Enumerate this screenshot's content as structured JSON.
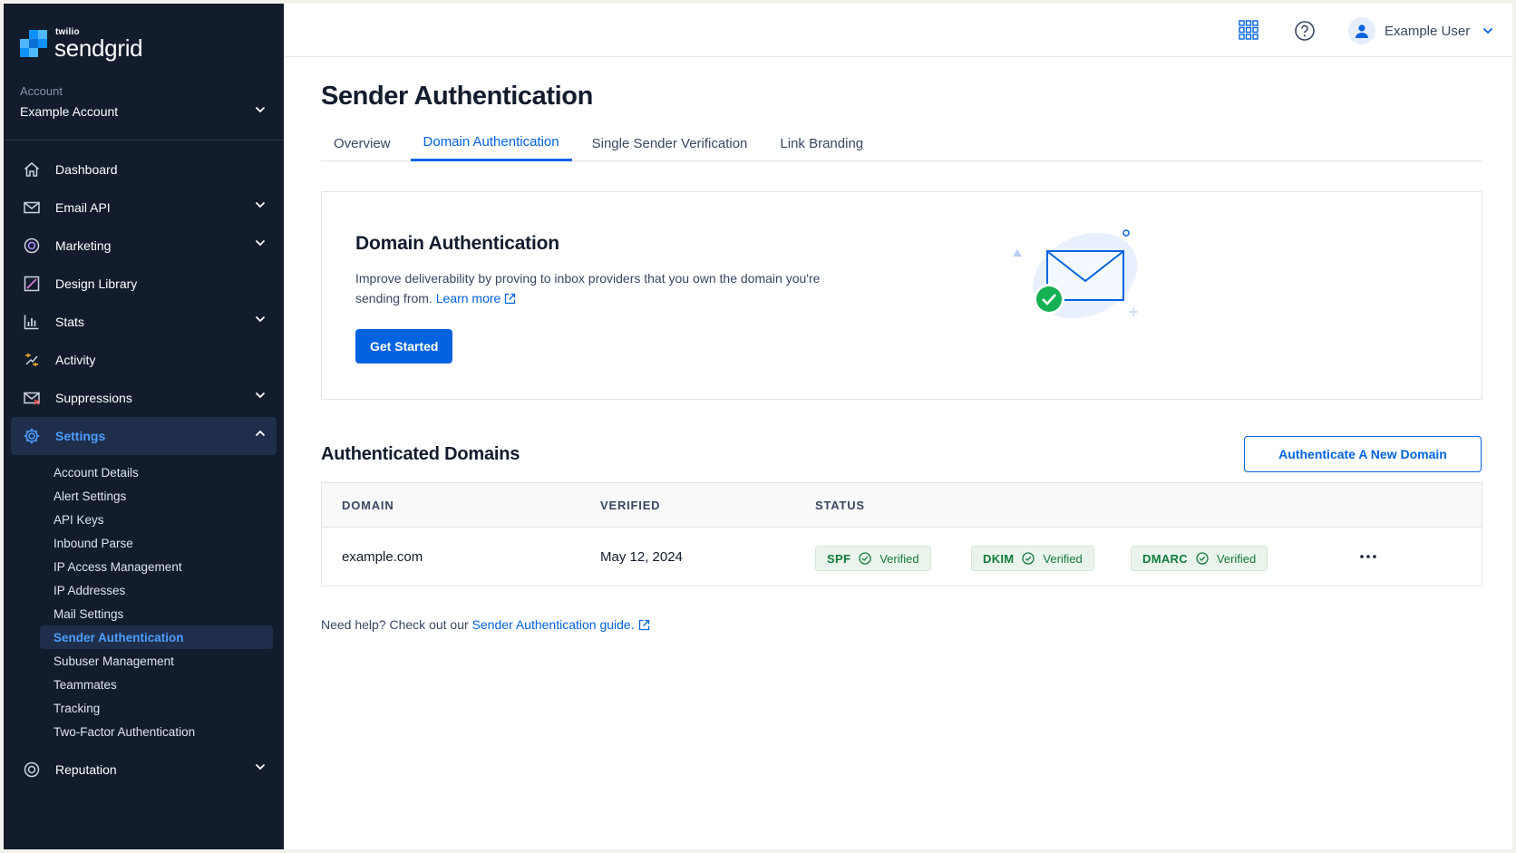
{
  "brand": {
    "small": "twilio",
    "big": "sendgrid"
  },
  "account": {
    "label": "Account",
    "name": "Example Account"
  },
  "nav": {
    "items": [
      {
        "label": "Dashboard",
        "icon": "home-icon",
        "chevron": false
      },
      {
        "label": "Email API",
        "icon": "envelope-icon",
        "chevron": true
      },
      {
        "label": "Marketing",
        "icon": "marketing-icon",
        "chevron": true
      },
      {
        "label": "Design Library",
        "icon": "design-icon",
        "chevron": false
      },
      {
        "label": "Stats",
        "icon": "bar-chart-icon",
        "chevron": true
      },
      {
        "label": "Activity",
        "icon": "activity-icon",
        "chevron": false
      },
      {
        "label": "Suppressions",
        "icon": "suppressions-icon",
        "chevron": true
      },
      {
        "label": "Settings",
        "icon": "gear-icon",
        "chevron": true,
        "expanded": true
      },
      {
        "label": "Reputation",
        "icon": "reputation-icon",
        "chevron": true
      }
    ],
    "settings_sub": [
      "Account Details",
      "Alert Settings",
      "API Keys",
      "Inbound Parse",
      "IP Access Management",
      "IP Addresses",
      "Mail Settings",
      "Sender Authentication",
      "Subuser Management",
      "Teammates",
      "Tracking",
      "Two-Factor Authentication"
    ],
    "active_sub": "Sender Authentication"
  },
  "topbar": {
    "user_name": "Example User",
    "icons": [
      "app-grid-icon",
      "help-icon",
      "user-avatar-icon"
    ]
  },
  "page": {
    "title": "Sender Authentication",
    "tabs": [
      "Overview",
      "Domain Authentication",
      "Single Sender Verification",
      "Link Branding"
    ],
    "active_tab": "Domain Authentication"
  },
  "hero": {
    "title": "Domain Authentication",
    "text": "Improve deliverability by proving to inbox providers that you own the domain you're sending from.",
    "learn_more": "Learn more",
    "button": "Get Started"
  },
  "domains": {
    "title": "Authenticated Domains",
    "add_button": "Authenticate A New Domain",
    "columns": [
      "DOMAIN",
      "VERIFIED",
      "STATUS"
    ],
    "rows": [
      {
        "domain": "example.com",
        "verified": "May 12, 2024",
        "statuses": [
          {
            "key": "SPF",
            "value": "Verified"
          },
          {
            "key": "DKIM",
            "value": "Verified"
          },
          {
            "key": "DMARC",
            "value": "Verified"
          }
        ]
      }
    ]
  },
  "help": {
    "text": "Need help? Check out our ",
    "link": "Sender Authentication guide."
  },
  "colors": {
    "sidebar": "#121c2d",
    "accent": "#0263e0",
    "active_nav": "#4d9cff",
    "success": "#0e7c3a"
  }
}
